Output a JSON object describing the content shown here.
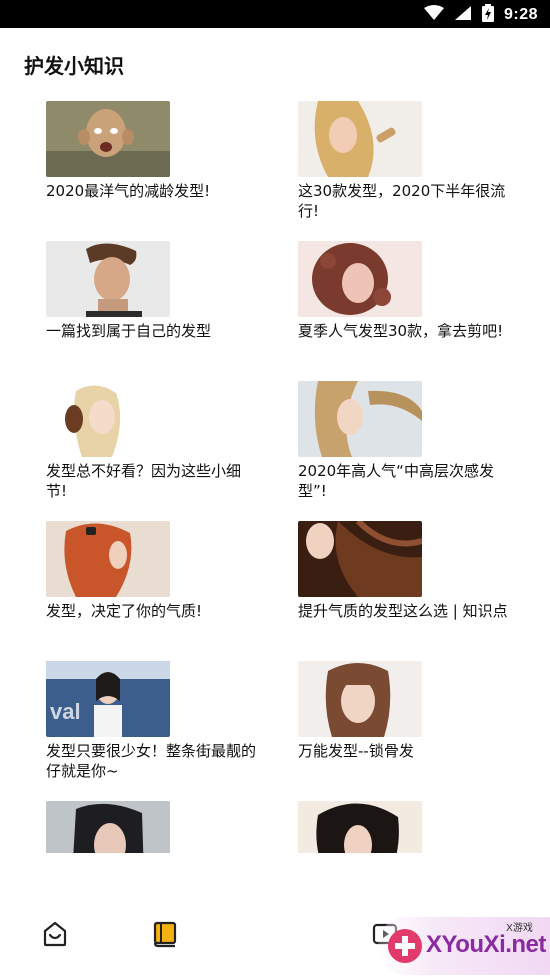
{
  "status_bar": {
    "time": "9:28"
  },
  "page": {
    "title": "护发小知识"
  },
  "articles": [
    {
      "title": "2020最洋气的减龄发型!"
    },
    {
      "title": "这30款发型，2020下半年很流行!"
    },
    {
      "title": "一篇找到属于自己的发型"
    },
    {
      "title": "夏季人气发型30款，拿去剪吧!"
    },
    {
      "title": "发型总不好看？因为这些小细节!"
    },
    {
      "title": "2020年高人气“中高层次感发型”!"
    },
    {
      "title": "发型，决定了你的气质!"
    },
    {
      "title": "提升气质的发型这么选 | 知识点"
    },
    {
      "title": "发型只要很少女！整条街最靓的仔就是你~"
    },
    {
      "title": "万能发型--锁骨发"
    },
    {
      "title": ""
    },
    {
      "title": ""
    }
  ],
  "watermark": {
    "brand": "XYouXi.net",
    "sub": "X游戏"
  },
  "colors": {
    "accent": "#f5b014",
    "status_bar": "#000000",
    "watermark": "#8a2aa0"
  },
  "icons": [
    "wifi-icon",
    "signal-icon",
    "battery-icon",
    "home-icon",
    "book-icon",
    "camera-icon"
  ]
}
